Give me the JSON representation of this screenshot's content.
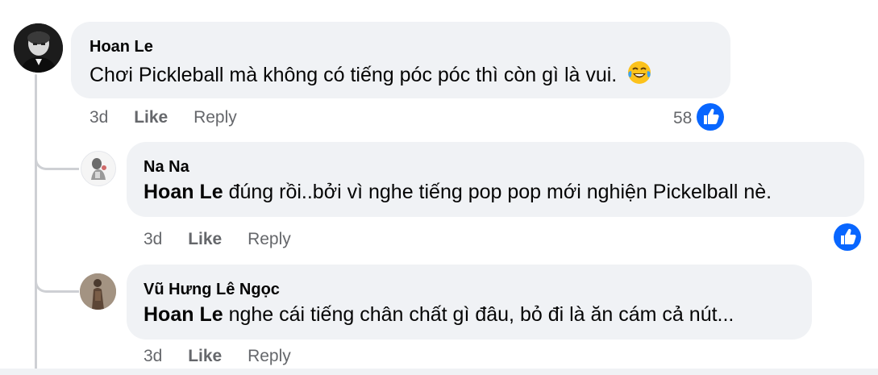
{
  "comments": [
    {
      "author": "Hoan Le",
      "mention": "",
      "text": "Chơi Pickleball mà không có tiếng póc póc thì còn gì là vui.",
      "emoji_icon": "tears-of-joy-emoji-icon",
      "time": "3d",
      "like_label": "Like",
      "reply_label": "Reply",
      "reaction_count": "58"
    },
    {
      "author": "Na Na",
      "mention": "Hoan Le",
      "text": " đúng rồi..bởi vì nghe tiếng pop pop mới nghiện Pickelball nè.",
      "time": "3d",
      "like_label": "Like",
      "reply_label": "Reply",
      "reaction_count": ""
    },
    {
      "author": "Vũ Hưng Lê Ngọc",
      "mention": "Hoan Le",
      "text": " nghe cái tiếng chân chất gì đâu, bỏ đi là ăn cám cả nút...",
      "time": "3d",
      "like_label": "Like",
      "reply_label": "Reply",
      "reaction_count": ""
    }
  ],
  "colors": {
    "bubble": "#f0f2f5",
    "like_blue": "#0866ff",
    "meta_gray": "#65676b",
    "thread_line": "#ced0d4"
  }
}
